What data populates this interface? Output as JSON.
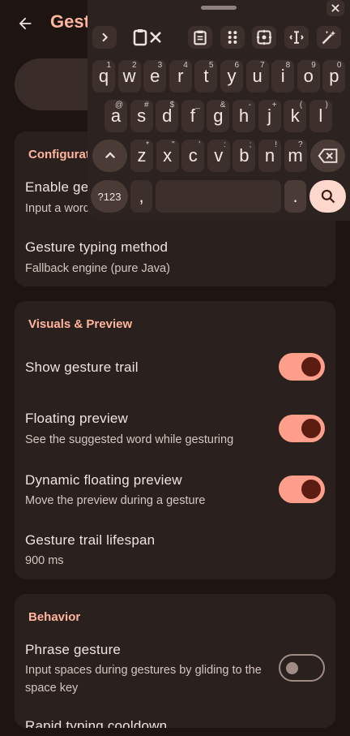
{
  "app_bar": {
    "title": "Gesture typing"
  },
  "sections": [
    {
      "header": "Configuration",
      "rows": [
        {
          "title": "Enable gesture typing",
          "subtitle": "Input a word by sliding through its letters"
        },
        {
          "title": "Gesture typing method",
          "subtitle": "Fallback engine (pure Java)"
        }
      ]
    },
    {
      "header": "Visuals & Preview",
      "rows": [
        {
          "title": "Show gesture trail",
          "toggle": true
        },
        {
          "title": "Floating preview",
          "subtitle": "See the suggested word while gesturing",
          "toggle": true
        },
        {
          "title": "Dynamic floating preview",
          "subtitle": "Move the preview during a gesture",
          "toggle": true
        },
        {
          "title": "Gesture trail lifespan",
          "subtitle": "900 ms"
        }
      ]
    },
    {
      "header": "Behavior",
      "rows": [
        {
          "title": "Phrase gesture",
          "subtitle": "Input spaces during gestures by gliding to the space key",
          "toggle": false
        },
        {
          "title": "Rapid typing cooldown"
        }
      ]
    }
  ],
  "keyboard": {
    "toolbar_icons": [
      "chevron-right-icon",
      "clipboard-clear-icon",
      "clipboard-icon",
      "numpad-icon",
      "cursor-move-icon",
      "text-select-icon",
      "magic-wand-icon"
    ],
    "row1": [
      {
        "k": "q",
        "h": "1"
      },
      {
        "k": "w",
        "h": "2"
      },
      {
        "k": "e",
        "h": "3"
      },
      {
        "k": "r",
        "h": "4"
      },
      {
        "k": "t",
        "h": "5"
      },
      {
        "k": "y",
        "h": "6"
      },
      {
        "k": "u",
        "h": "7"
      },
      {
        "k": "i",
        "h": "8"
      },
      {
        "k": "o",
        "h": "9"
      },
      {
        "k": "p",
        "h": "0"
      }
    ],
    "row2": [
      {
        "k": "a",
        "h": "@"
      },
      {
        "k": "s",
        "h": "#"
      },
      {
        "k": "d",
        "h": "$"
      },
      {
        "k": "f",
        "h": "_"
      },
      {
        "k": "g",
        "h": "&"
      },
      {
        "k": "h",
        "h": "-"
      },
      {
        "k": "j",
        "h": "+"
      },
      {
        "k": "k",
        "h": "("
      },
      {
        "k": "l",
        "h": ")"
      }
    ],
    "row3": [
      {
        "k": "z",
        "h": "*"
      },
      {
        "k": "x",
        "h": "\""
      },
      {
        "k": "c",
        "h": "'"
      },
      {
        "k": "v",
        "h": ":"
      },
      {
        "k": "b",
        "h": ";"
      },
      {
        "k": "n",
        "h": "!"
      },
      {
        "k": "m",
        "h": "?"
      }
    ],
    "symbols_label": "?123",
    "comma": ",",
    "period": ".",
    "accent_color": "#ffd8cd"
  }
}
